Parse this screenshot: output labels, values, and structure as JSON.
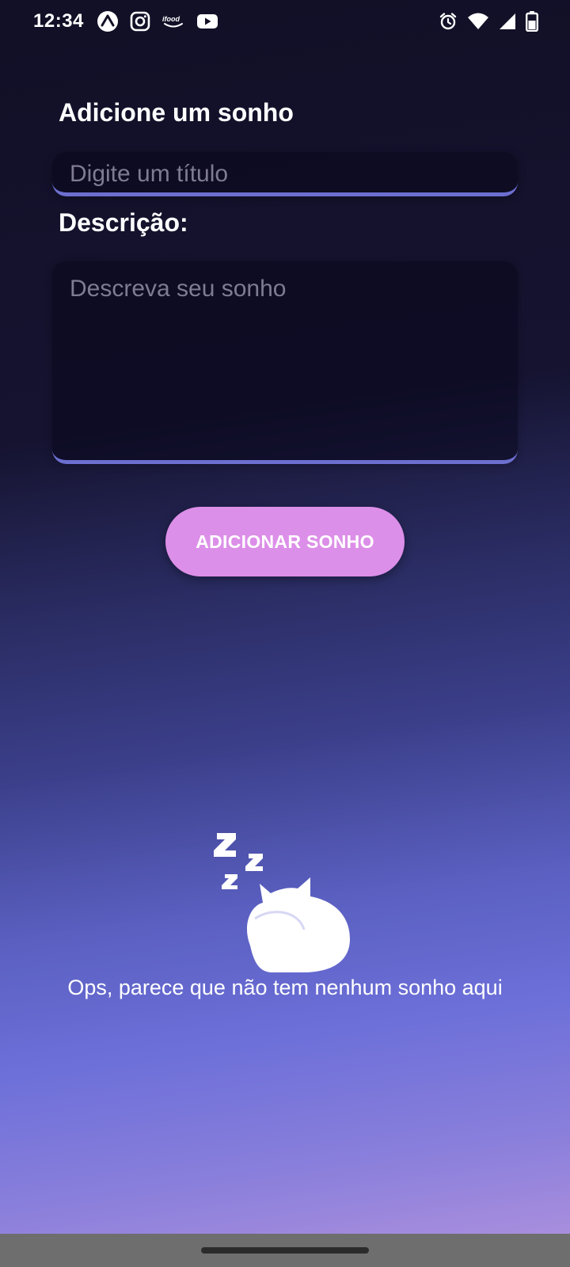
{
  "status_bar": {
    "time": "12:34",
    "app_icons": [
      "expo-icon",
      "instagram-icon",
      "ifood-icon",
      "youtube-icon"
    ],
    "ifood_text": "ifood",
    "system_icons": [
      "alarm-icon",
      "wifi-icon",
      "cell-signal-icon",
      "battery-icon"
    ]
  },
  "form": {
    "title_heading": "Adicione um sonho",
    "title_placeholder": "Digite um título",
    "title_value": "",
    "description_heading": "Descrição:",
    "description_placeholder": "Descreva seu sonho",
    "description_value": "",
    "add_button_label": "ADICIONAR SONHO"
  },
  "empty_state": {
    "illustration": "sleeping-cat-icon",
    "message": "Ops, parece que não tem nenhum sonho aqui"
  },
  "colors": {
    "accent_underline": "#6c6fd0",
    "button": "#dc8fe8",
    "background_top": "#121026",
    "background_bottom": "#b293de"
  }
}
